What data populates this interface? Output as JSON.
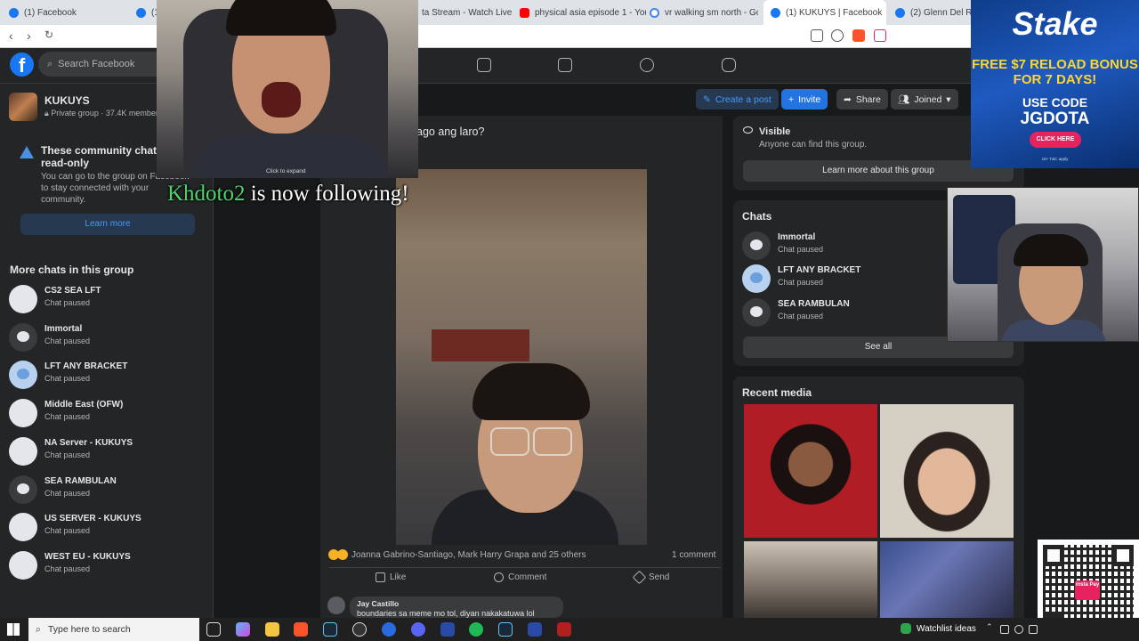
{
  "browser": {
    "tabs": [
      {
        "label": "(1) Facebook",
        "icon": "facebook-icon"
      },
      {
        "label": "(1",
        "icon": "facebook-icon"
      },
      {
        "label": "ta Stream - Watch Live on",
        "icon": "stream-icon"
      },
      {
        "label": "physical asia episode 1 - YouTu",
        "icon": "youtube-icon"
      },
      {
        "label": "vr walking sm north - Google S",
        "icon": "google-icon"
      },
      {
        "label": "(1) KUKUYS | Facebook",
        "icon": "facebook-icon",
        "active": true
      },
      {
        "label": "(2) Glenn Del Rosari",
        "icon": "facebook-icon"
      }
    ]
  },
  "facebook": {
    "search_placeholder": "Search Facebook",
    "group": {
      "name": "KUKUYS",
      "meta": "Private group · 37.4K member"
    },
    "notice": {
      "title": "These community chats are read-only",
      "body": "You can go to the group on Facebook to stay connected with your community.",
      "button": "Learn more"
    },
    "more_chats_title": "More chats in this group",
    "more_chats": [
      {
        "name": "CS2 SEA LFT",
        "status": "Chat paused",
        "avatar": "plain"
      },
      {
        "name": "Immortal",
        "status": "Chat paused",
        "avatar": "dark"
      },
      {
        "name": "LFT ANY BRACKET",
        "status": "Chat paused",
        "avatar": "blue"
      },
      {
        "name": "Middle East (OFW)",
        "status": "Chat paused",
        "avatar": "plain"
      },
      {
        "name": "NA Server - KUKUYS",
        "status": "Chat paused",
        "avatar": "plain"
      },
      {
        "name": "SEA RAMBULAN",
        "status": "Chat paused",
        "avatar": "dark"
      },
      {
        "name": "US SERVER - KUKUYS",
        "status": "Chat paused",
        "avatar": "plain"
      },
      {
        "name": "WEST EU - KUKUYS",
        "status": "Chat paused",
        "avatar": "plain"
      }
    ],
    "header_buttons": {
      "create_post": "Create a post",
      "invite": "Invite",
      "share": "Share",
      "joined": "Joined"
    },
    "post": {
      "text": "ago ang laro?",
      "reactions": "Joanna Gabrino-Santiago, Mark Harry Grapa and 25 others",
      "comment_count": "1 comment",
      "actions": {
        "like": "Like",
        "comment": "Comment",
        "send": "Send"
      },
      "comment": {
        "author": "Jay Castillo",
        "text": "boundaries sa meme mo tol, diyan nakakatuwa lol"
      }
    },
    "about": {
      "visible_title": "Visible",
      "visible_desc": "Anyone can find this group.",
      "learn_button": "Learn more about this group"
    },
    "chats": {
      "title": "Chats",
      "items": [
        {
          "name": "Immortal",
          "status": "Chat paused",
          "avatar": "dark"
        },
        {
          "name": "LFT ANY BRACKET",
          "status": "Chat paused",
          "avatar": "blue"
        },
        {
          "name": "SEA RAMBULAN",
          "status": "Chat paused",
          "avatar": "dark"
        }
      ],
      "see_all": "See all"
    },
    "recent_media_title": "Recent media"
  },
  "overlays": {
    "expand_label": "Click to expand",
    "follow_name": "Khdoto2",
    "follow_text": " is now following!",
    "stake": {
      "logo": "Stake",
      "line1": "FREE $7 RELOAD BONUS FOR 7 DAYS!",
      "line2": "USE CODE",
      "code": "JGDOTA",
      "cta": "CLICK HERE",
      "fine": "18+ T&C apply"
    },
    "qr_logo": "insta Pay"
  },
  "taskbar": {
    "search_placeholder": "Type here to search",
    "watchlist": "Watchlist ideas"
  }
}
